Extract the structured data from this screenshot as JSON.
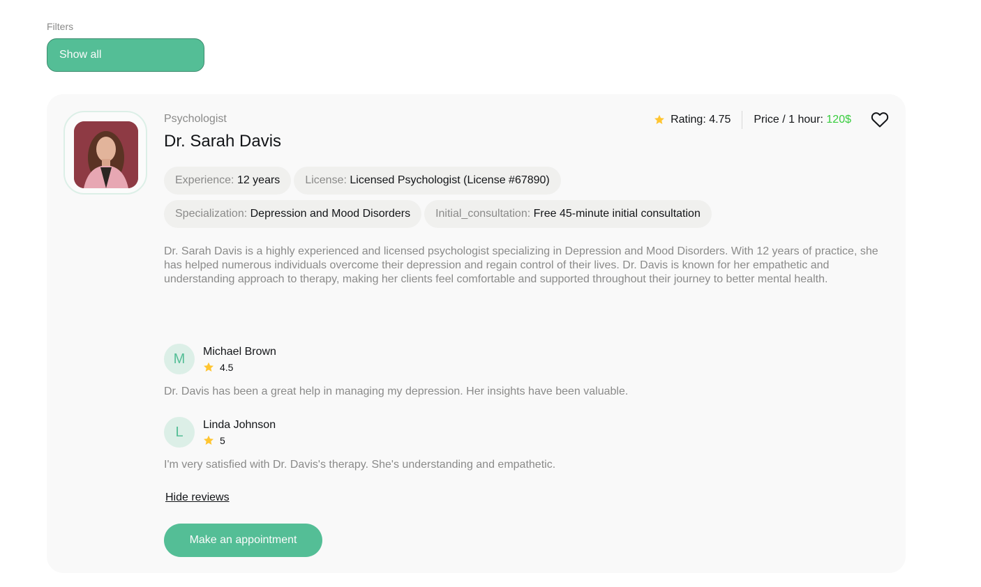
{
  "filters": {
    "label": "Filters",
    "selected": "Show all"
  },
  "doctor": {
    "profession": "Psychologist",
    "name": "Dr. Sarah Davis",
    "rating_label": "Rating: 4.75",
    "price_label": "Price / 1 hour: ",
    "price_value": "120$",
    "details": [
      {
        "key": "Experience: ",
        "value": "12 years"
      },
      {
        "key": "License: ",
        "value": "Licensed Psychologist (License #67890)"
      },
      {
        "key": "Specialization: ",
        "value": "Depression and Mood Disorders"
      },
      {
        "key": "Initial_consultation: ",
        "value": "Free 45-minute initial consultation"
      }
    ],
    "about": "Dr. Sarah Davis is a highly experienced and licensed psychologist specializing in Depression and Mood Disorders. With 12 years of practice, she has helped numerous individuals overcome their depression and regain control of their lives. Dr. Davis is known for her empathetic and understanding approach to therapy, making her clients feel comfortable and supported throughout their journey to better mental health."
  },
  "reviews": [
    {
      "initial": "M",
      "name": "Michael Brown",
      "rating": "4.5",
      "comment": "Dr. Davis has been a great help in managing my depression. Her insights have been valuable."
    },
    {
      "initial": "L",
      "name": "Linda Johnson",
      "rating": "5",
      "comment": "I'm very satisfied with Dr. Davis's therapy. She's understanding and empathetic."
    }
  ],
  "actions": {
    "hide_reviews": "Hide reviews",
    "appointment": "Make an appointment"
  },
  "colors": {
    "accent": "#54be96",
    "price": "#38cd3e",
    "star": "#ffc531",
    "card_bg": "#f9f9f9"
  },
  "icons": [
    "star-icon",
    "heart-icon"
  ]
}
